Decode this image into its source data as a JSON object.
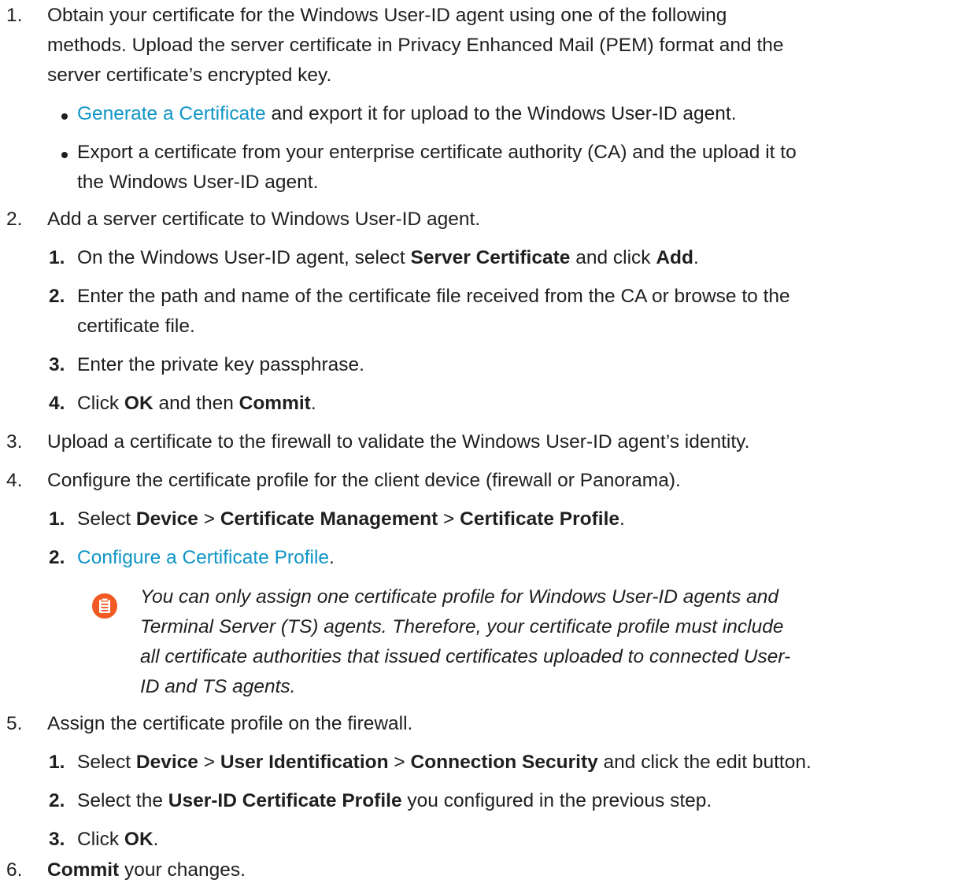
{
  "steps": [
    {
      "number": "1.",
      "lines": [
        "Obtain your certificate for the Windows User-ID agent using one of the following",
        "methods. Upload the server certificate in Privacy Enhanced Mail (PEM) format and the",
        "server certificate’s encrypted key."
      ],
      "bullets": [
        {
          "link": "Generate a Certificate",
          "text": " and export it for upload to the Windows User-ID agent."
        },
        {
          "lines": [
            "Export a certificate from your enterprise certificate authority (CA) and the upload it to",
            "the Windows User-ID agent."
          ]
        }
      ]
    },
    {
      "number": "2.",
      "text": "Add a server certificate to Windows User-ID agent.",
      "substeps": [
        {
          "number": "1.",
          "pre": "On the Windows User-ID agent, select ",
          "b1": "Server Certificate",
          "mid": " and click ",
          "b2": "Add",
          "post": "."
        },
        {
          "number": "2.",
          "lines": [
            "Enter the path and name of the certificate file received from the CA or browse to the",
            "certificate file."
          ]
        },
        {
          "number": "3.",
          "text": "Enter the private key passphrase."
        },
        {
          "number": "4.",
          "pre": "Click ",
          "b1": "OK",
          "mid": " and then ",
          "b2": "Commit",
          "post": "."
        }
      ]
    },
    {
      "number": "3.",
      "text": "Upload a certificate to the firewall to validate the Windows User-ID agent’s identity."
    },
    {
      "number": "4.",
      "text": "Configure the certificate profile for the client device (firewall or Panorama).",
      "substeps": [
        {
          "number": "1.",
          "pre": "Select ",
          "b1": "Device",
          "sep1": " > ",
          "b2": "Certificate Management",
          "sep2": " > ",
          "b3": "Certificate Profile",
          "post": "."
        },
        {
          "number": "2.",
          "link": "Configure a Certificate Profile",
          "post": "."
        }
      ],
      "note": {
        "icon": "note-icon",
        "lines": [
          "You can only assign one certificate profile for Windows User-ID agents and",
          "Terminal Server (TS) agents. Therefore, your certificate profile must include",
          "all certificate authorities that issued certificates uploaded to connected User-",
          "ID and TS agents."
        ]
      }
    },
    {
      "number": "5.",
      "text": "Assign the certificate profile on the firewall.",
      "substeps": [
        {
          "number": "1.",
          "pre": "Select ",
          "b1": "Device",
          "sep1": " > ",
          "b2": "User Identification",
          "sep2": " > ",
          "b3": "Connection Security",
          "post": " and click the edit button."
        },
        {
          "number": "2.",
          "pre": "Select the ",
          "b1": "User-ID Certificate Profile",
          "post": " you configured in the previous step."
        },
        {
          "number": "3.",
          "pre": "Click ",
          "b1": "OK",
          "post": "."
        }
      ]
    },
    {
      "number": "6.",
      "b1": "Commit",
      "post": " your changes."
    }
  ],
  "colors": {
    "text": "#1f1f1f",
    "link": "#0f95c6",
    "note_icon": "#f15a22"
  }
}
